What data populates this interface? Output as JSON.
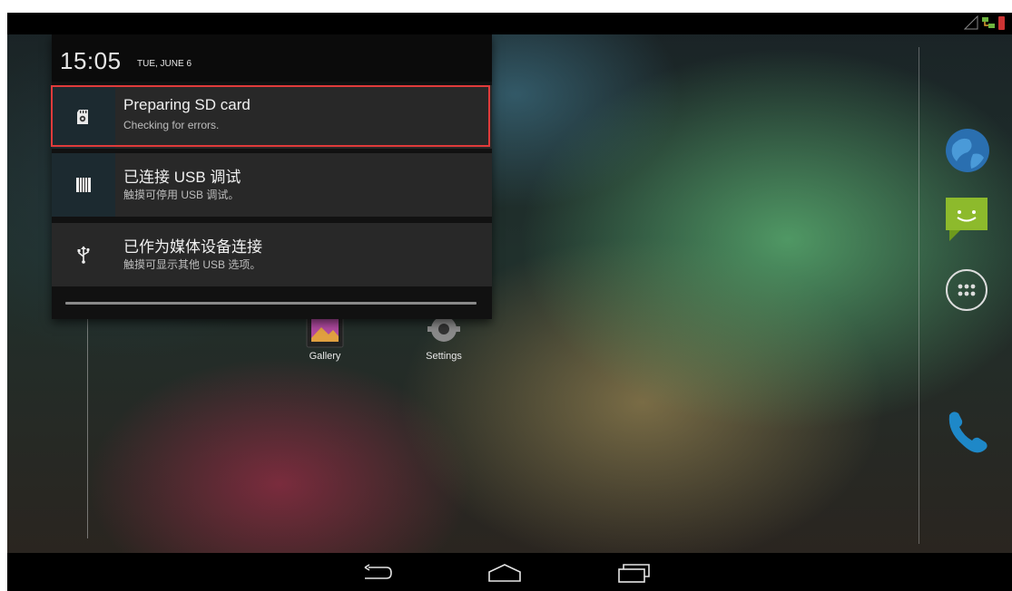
{
  "status_bar": {
    "icons": [
      "signal-icon",
      "network-icon",
      "battery-icon"
    ]
  },
  "notification_shade": {
    "time": "15:05",
    "date": "TUE, JUNE 6",
    "notifications": [
      {
        "icon": "sd-card-icon",
        "title": "Preparing SD card",
        "subtitle": "Checking for errors."
      },
      {
        "icon": "usb-debug-icon",
        "title": "已连接 USB 调试",
        "subtitle": "触摸可停用 USB 调试。"
      },
      {
        "icon": "usb-icon",
        "title": "已作为媒体设备连接",
        "subtitle": "触摸可显示其他 USB 选项。"
      }
    ],
    "highlight_color": "#e03b3b"
  },
  "home_screen": {
    "apps": [
      {
        "icon": "gallery-icon",
        "label": "Gallery"
      },
      {
        "icon": "settings-icon",
        "label": "Settings"
      }
    ],
    "dock": [
      "browser-icon",
      "messaging-icon",
      "all-apps-icon",
      "phone-icon"
    ]
  },
  "navigation_bar": {
    "buttons": [
      "back-icon",
      "home-icon",
      "recent-apps-icon"
    ]
  }
}
